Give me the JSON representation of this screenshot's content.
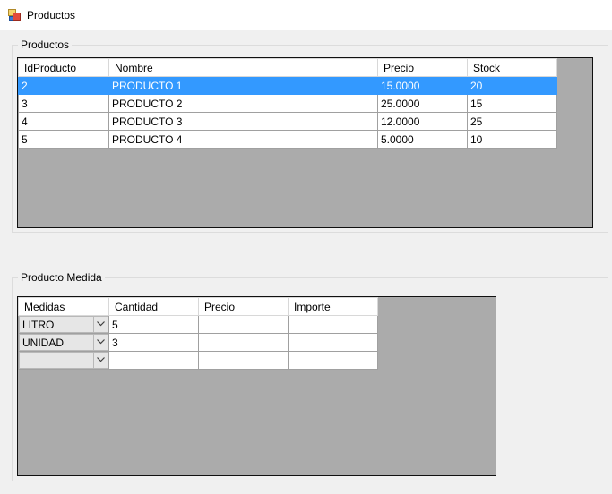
{
  "window": {
    "title": "Productos"
  },
  "productos_group": {
    "label": "Productos",
    "columns": [
      "IdProducto",
      "Nombre",
      "Precio",
      "Stock"
    ],
    "rows": [
      [
        "2",
        "PRODUCTO 1",
        "15.0000",
        "20"
      ],
      [
        "3",
        "PRODUCTO 2",
        "25.0000",
        "15"
      ],
      [
        "4",
        "PRODUCTO 3",
        "12.0000",
        "25"
      ],
      [
        "5",
        "PRODUCTO 4",
        "5.0000",
        "10"
      ]
    ],
    "selected_row": 0
  },
  "medida_group": {
    "label": "Producto Medida",
    "columns": [
      "Medidas",
      "Cantidad",
      "Precio",
      "Importe"
    ],
    "rows": [
      {
        "medida": "LITRO",
        "cantidad": "5",
        "precio": "",
        "importe": ""
      },
      {
        "medida": "UNIDAD",
        "cantidad": "3",
        "precio": "",
        "importe": ""
      },
      {
        "medida": "",
        "cantidad": "",
        "precio": "",
        "importe": ""
      }
    ]
  },
  "colors": {
    "selection": "#3399ff",
    "grid_background": "#ababab"
  },
  "icons": {
    "app": "window-app-icon",
    "dropdown": "chevron-down-icon"
  }
}
